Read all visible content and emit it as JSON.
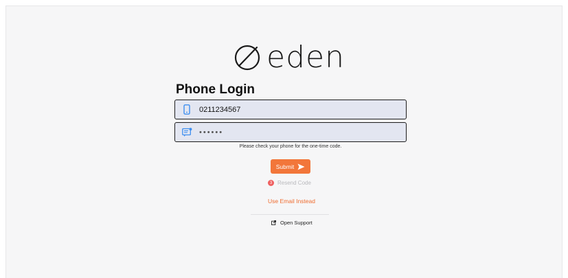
{
  "brand": {
    "name": "eden",
    "logo_icon": "circle-slash-logo"
  },
  "login": {
    "title": "Phone Login",
    "phone": {
      "value": "0211234567",
      "icon": "phone-icon"
    },
    "code": {
      "value": "••••••",
      "icon": "message-code-icon"
    },
    "hint": "Please check your phone for the one-time code.",
    "submit_label": "Submit",
    "resend": {
      "count": "3",
      "label": "Resend Code"
    },
    "use_email_label": "Use Email Instead",
    "support_label": "Open Support"
  },
  "colors": {
    "accent": "#f2763a",
    "field_bg": "#e3e6f1",
    "badge": "#ef5f5f",
    "icon_blue": "#3d8ef0"
  }
}
